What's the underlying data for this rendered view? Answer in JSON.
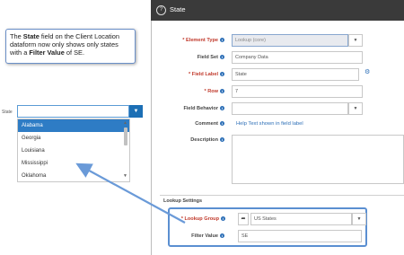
{
  "callout": {
    "part1": "The ",
    "bold1": "State",
    "part2": " field on the Client Location dataform now only shows only states with a ",
    "bold2": "Filter Value",
    "part3": " of SE."
  },
  "dropdown": {
    "label": "State",
    "value": "",
    "options": [
      "Alabama",
      "Georgia",
      "Louisiana",
      "Mississippi",
      "Oklahoma"
    ],
    "selected_index": 0,
    "button_icon": "caret-down-icon"
  },
  "panel": {
    "title": "State",
    "title_icon": "circle-question-icon",
    "fields": {
      "element_type": {
        "label": "Element Type",
        "required": true,
        "value": "Lookup (core)"
      },
      "field_set": {
        "label": "Field Set",
        "required": false,
        "value": "Company Data"
      },
      "field_label": {
        "label": "Field Label",
        "required": true,
        "value": "State"
      },
      "row": {
        "label": "Row",
        "required": true,
        "value": "7"
      },
      "field_behavior": {
        "label": "Field Behavior",
        "required": false,
        "value": ""
      },
      "comment": {
        "label": "Comment",
        "required": false,
        "value": "Help Text shown in field label"
      },
      "description": {
        "label": "Description",
        "required": false,
        "value": ""
      }
    },
    "lookup_settings": {
      "section_title": "Lookup Settings",
      "lookup_group": {
        "label": "Lookup Group",
        "required": true,
        "value": "US States"
      },
      "filter_value": {
        "label": "Filter Value",
        "required": false,
        "value": "SE"
      }
    }
  },
  "colors": {
    "accent": "#1c6fb5",
    "highlight": "#5b8fd1",
    "required": "#c0392b",
    "titlebar": "#3a3a3a"
  }
}
